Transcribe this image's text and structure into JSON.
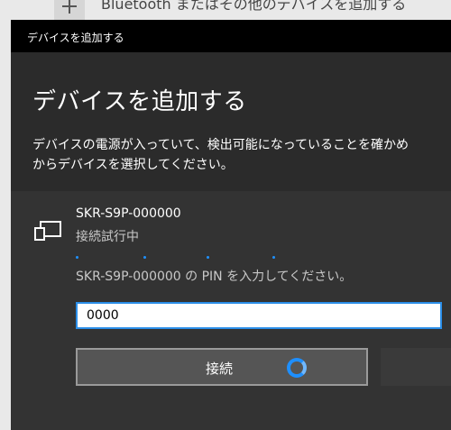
{
  "background_settings": {
    "partial_text": "Bluetooth またはその他のデバイスを追加する",
    "add_icon": "plus-icon"
  },
  "dialog": {
    "title": "デバイスを追加する",
    "heading": "デバイスを追加する",
    "description_line1": "デバイスの電源が入っていて、検出可能になっていることを確かめ",
    "description_line2": "からデバイスを選択してください。"
  },
  "device": {
    "icon": "device-icon",
    "name": "SKR-S9P-000000",
    "status": "接続試行中",
    "pin_prompt": "SKR-S9P-000000 の PIN を入力してください。",
    "pin_value": "0000"
  },
  "actions": {
    "connect_label": "接続",
    "spinner_icon": "loading-spinner-icon"
  },
  "colors": {
    "accent": "#1e8fff",
    "dialog_bg": "#2b2b2b",
    "panel_bg": "#333333",
    "titlebar_bg": "#000000"
  }
}
